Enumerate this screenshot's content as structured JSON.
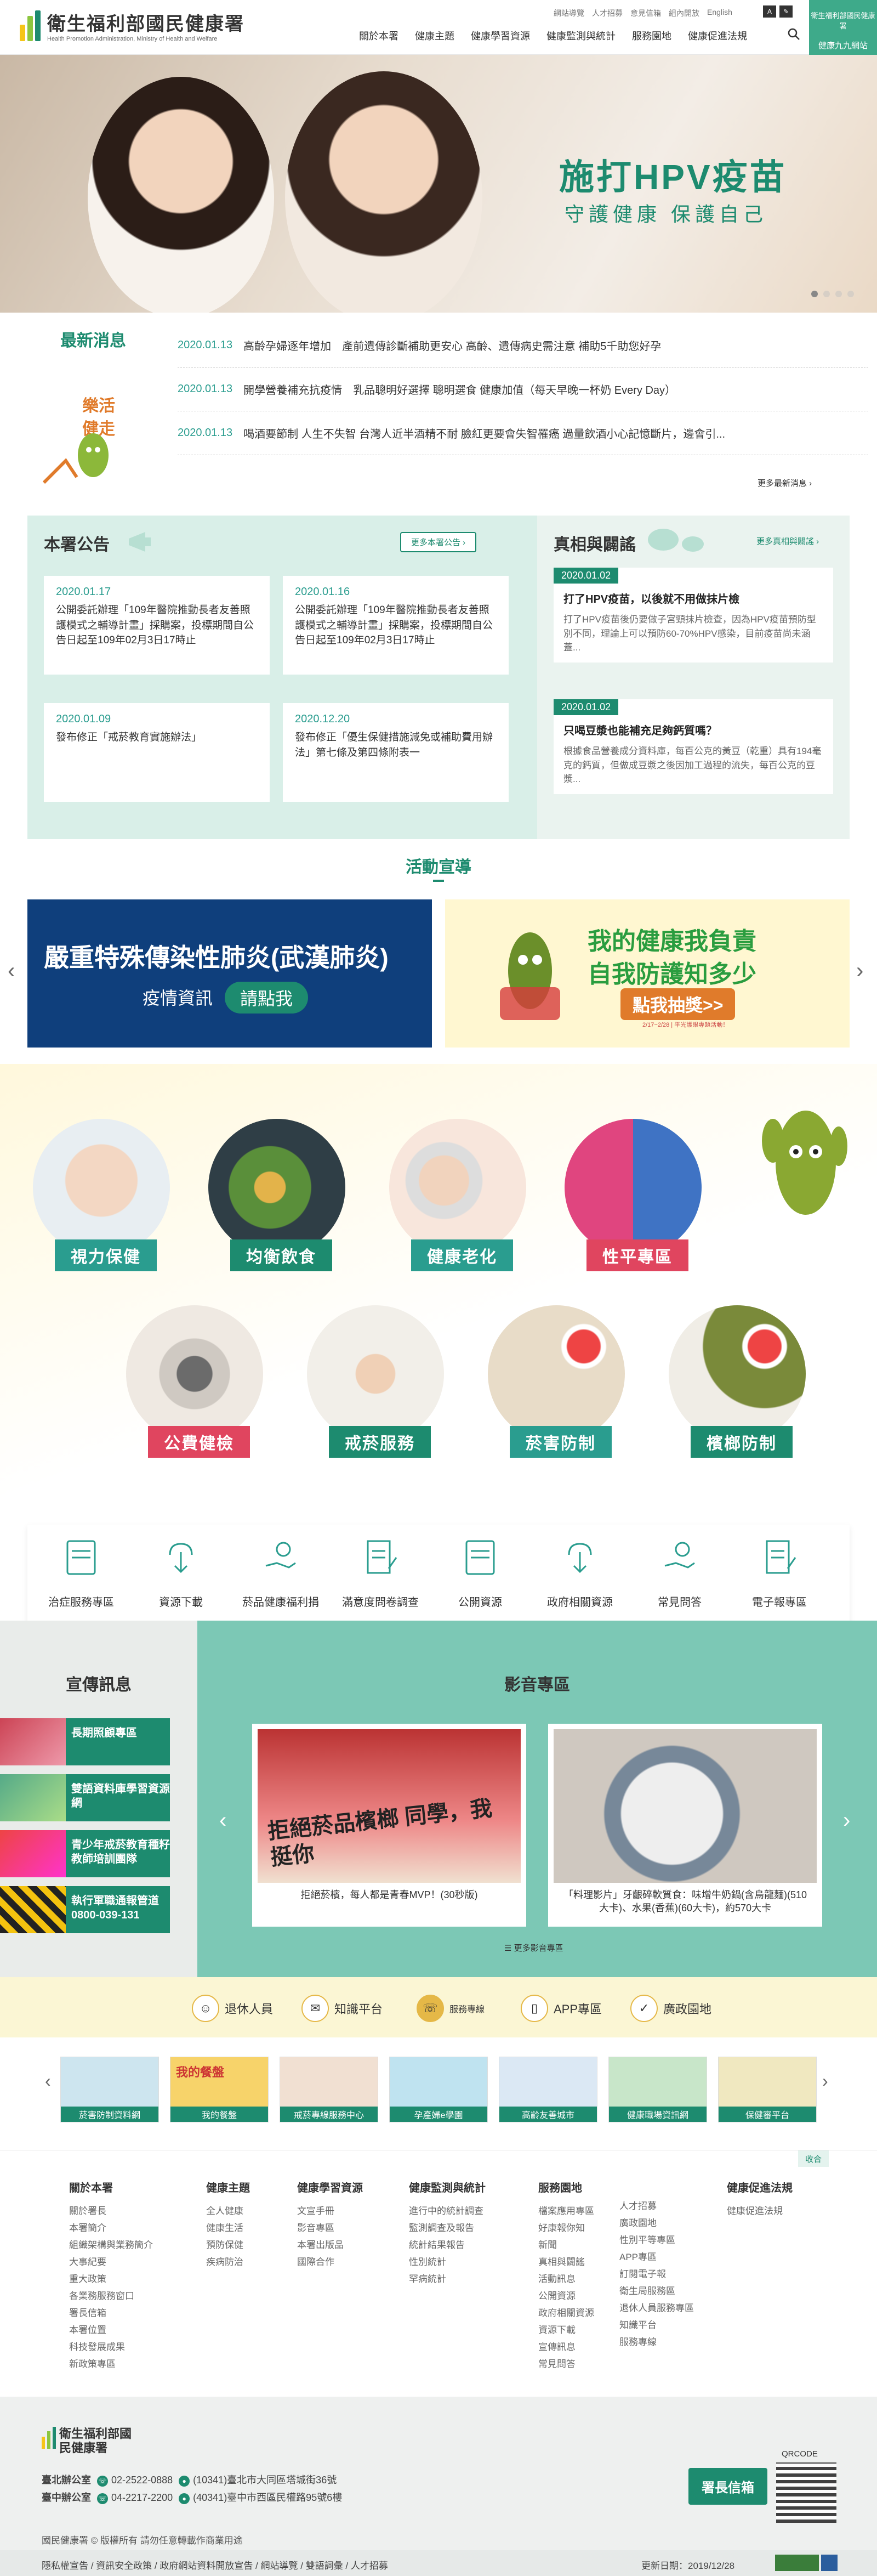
{
  "header": {
    "logo_title": "衛生福利部國民健康署",
    "logo_sub": "Health Promotion Administration, Ministry of Health and Welfare",
    "util_links": [
      "網站導覽",
      "人才招募",
      "意見信箱",
      "組內開放",
      "English"
    ],
    "font_label": "A",
    "nav": [
      "關於本署",
      "健康主題",
      "健康學習資源",
      "健康監測與統計",
      "服務園地",
      "健康促進法規"
    ],
    "corner_title": "衛生福利部國民健康署",
    "corner_sub": "健康九九網站"
  },
  "hero": {
    "title": "施打HPV疫苗",
    "subtitle": "守護健康 保護自己"
  },
  "news": {
    "title": "最新消息",
    "side_text": "樂活健走",
    "items": [
      {
        "date": "2020.01.13",
        "text": "高齡孕婦逐年增加　產前遺傳診斷補助更安心 高齡、遺傳病史需注意 補助5千助您好孕"
      },
      {
        "date": "2020.01.13",
        "text": "開學營養補充抗疫情　乳品聰明好選擇 聰明選食 健康加值（每天早晚一杯奶 Every Day）"
      },
      {
        "date": "2020.01.13",
        "text": "喝酒要節制 人生不失智 台灣人近半酒精不耐 臉紅更要會失智罹癌 過量飲酒小心記憶斷片，邊會引..."
      }
    ],
    "more": "更多最新消息"
  },
  "announcements": {
    "title": "本署公告",
    "more": "更多本署公告",
    "cards": [
      {
        "date": "2020.01.17",
        "text": "公開委託辦理「109年醫院推動長者友善照護模式之輔導計畫」採購案，投標期間自公告日起至109年02月3日17時止"
      },
      {
        "date": "2020.01.16",
        "text": "公開委託辦理「109年醫院推動長者友善照護模式之輔導計畫」採購案，投標期間自公告日起至109年02月3日17時止"
      },
      {
        "date": "2020.01.09",
        "text": "發布修正「戒菸教育實施辦法」"
      },
      {
        "date": "2020.12.20",
        "text": "發布修正「優生保健措施減免或補助費用辦法」第七條及第四條附表一"
      }
    ]
  },
  "truth": {
    "title": "真相與闢謠",
    "more": "更多真相與闢謠",
    "cards": [
      {
        "date": "2020.01.02",
        "title": "打了HPV疫苗，以後就不用做抹片檢",
        "body": "打了HPV疫苗後仍要做子宮頸抹片檢查，因為HPV疫苗預防型別不同，理論上可以預防60-70%HPV感染，目前疫苗尚未涵蓋..."
      },
      {
        "date": "2020.01.02",
        "title": "只喝豆漿也能補充足夠鈣質嗎？",
        "body": "根據食品營養成分資料庫，每百公克的黃豆（乾重）具有194毫克的鈣質，但做成豆漿之後因加工過程的流失，每百公克的豆漿..."
      }
    ]
  },
  "activities": {
    "title": "活動宣導",
    "banner_left_title": "嚴重特殊傳染性肺炎(武漢肺炎)",
    "banner_left_sub": "疫情資訊",
    "banner_left_btn": "請點我",
    "banner_right_l1": "我的健康我負責",
    "banner_right_l2": "自我防護知多少",
    "banner_right_btn": "點我抽獎>>",
    "banner_right_note": "2/17~2/28 | 平光護眼專題活動！"
  },
  "topics": [
    {
      "label": "視力保健",
      "color": "#2a9d8f"
    },
    {
      "label": "均衡飲食",
      "color": "#1d8b6f"
    },
    {
      "label": "健康老化",
      "color": "#2a9d8f"
    },
    {
      "label": "性平專區",
      "color": "#e0455f"
    },
    {
      "label": "公費健檢",
      "color": "#e0455f"
    },
    {
      "label": "戒菸服務",
      "color": "#1d8b6f"
    },
    {
      "label": "菸害防制",
      "color": "#2a9d8f"
    },
    {
      "label": "檳榔防制",
      "color": "#1d8b6f"
    }
  ],
  "services": [
    "治症服務專區",
    "資源下載",
    "菸品健康福利捐",
    "滿意度問卷調查",
    "公開資源",
    "政府相關資源",
    "常見問答",
    "電子報專區"
  ],
  "promo": {
    "title": "宣傳訊息",
    "items": [
      "長期照顧專區",
      "雙語資料庫學習資源網",
      "青少年戒菸教育種籽教師培訓團隊",
      "執行軍職通報管道0800-039-131"
    ]
  },
  "video": {
    "title": "影音專區",
    "cards": [
      {
        "caption": "拒絕菸檳，每人都是青春MVP！(30秒版)",
        "img_text": "拒絕菸品檳榔 同學，我挺你"
      },
      {
        "caption": "「料理影片」牙齦碎軟質食：味增牛奶鍋(含烏龍麵)(510大卡)、水果(香蕉)(60大卡)，約570大卡"
      }
    ],
    "more": "更多影音專區"
  },
  "quick": [
    "退休人員",
    "知識平台",
    "服務專線",
    "APP專區",
    "廣政園地"
  ],
  "thumbs": [
    "菸害防制資料網",
    "我的餐盤",
    "戒菸專線服務中心",
    "孕產婦e學園",
    "高齡友善城市",
    "健康職場資訊網",
    "保健審平台"
  ],
  "thumb_img_text": "我的餐盤",
  "sitemap": {
    "collapse": "收合",
    "cols": [
      {
        "h": "關於本署",
        "items": [
          "關於署長",
          "本署簡介",
          "組織架構與業務簡介",
          "大事紀要",
          "重大政策",
          "各業務服務窗口",
          "署長信箱",
          "本署位置",
          "科技發展成果",
          "新政策專區"
        ]
      },
      {
        "h": "健康主題",
        "items": [
          "全人健康",
          "健康生活",
          "預防保健",
          "疾病防治"
        ]
      },
      {
        "h": "健康學習資源",
        "items": [
          "文宣手冊",
          "影音專區",
          "本署出版品",
          "國際合作"
        ]
      },
      {
        "h": "健康監測與統計",
        "items": [
          "進行中的統計調查",
          "監測調查及報告",
          "統計結果報告",
          "性別統計",
          "罕病統計"
        ]
      },
      {
        "h": "服務園地",
        "items": [
          "檔案應用專區",
          "好康報你知",
          "新聞",
          "真相與闢謠",
          "活動訊息",
          "公開資源",
          "政府相關資源",
          "資源下載",
          "宣傳訊息",
          "常見問答"
        ]
      },
      {
        "h": "",
        "items": [
          "人才招募",
          "廣政園地",
          "性別平等專區",
          "APP專區",
          "訂閱電子報",
          "衛生局服務區",
          "退休人員服務專區",
          "知識平台",
          "服務專線"
        ]
      },
      {
        "h": "健康促進法規",
        "items": [
          "健康促進法規"
        ]
      }
    ]
  },
  "footer": {
    "logo": "衛生福利部國民健康署",
    "taipei_label": "臺北辦公室",
    "taipei_phone": "02-2522-0888",
    "taipei_addr": "(10341)臺北市大同區塔城街36號",
    "taichung_label": "臺中辦公室",
    "taichung_phone": "04-2217-2200",
    "taichung_addr": "(40341)臺中市西區民權路95號6樓",
    "mail_btn": "署長信箱",
    "qrcode_label": "QRCODE",
    "copyright": "國民健康署 © 版權所有 請勿任意轉載作商業用途",
    "bottom_links": "隱私權宣告 / 資訊安全政策 / 政府網站資料開放宣告 / 網站導覽 / 雙語詞彙 / 人才招募",
    "updated": "更新日期：2019/12/28"
  }
}
